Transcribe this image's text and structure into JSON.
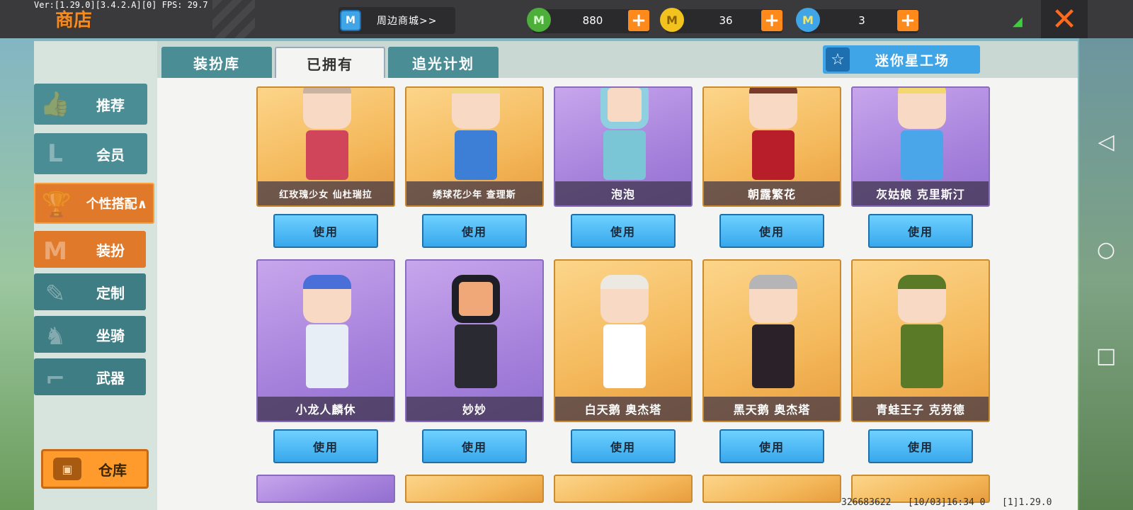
{
  "header": {
    "version": "Ver:[1.29.0][3.4.2.A][0] FPS: 29.7",
    "title": "商店",
    "mall_button": "周边商城>>",
    "mall_icon": "M",
    "currencies": [
      {
        "name": "mini-bean",
        "value": "880",
        "color": "#4caf3a",
        "icon": "M"
      },
      {
        "name": "mini-coin",
        "value": "36",
        "color": "#f2c21e",
        "icon": "M"
      },
      {
        "name": "mini-point",
        "value": "3",
        "color": "#3fa5e6",
        "icon": "M"
      }
    ],
    "plus": "+",
    "close": "✕"
  },
  "sidebar": {
    "items": [
      {
        "label": "推荐",
        "icon": "thumb-star-icon"
      },
      {
        "label": "会员",
        "icon": "l-badge-icon"
      },
      {
        "label": "个性搭配∧",
        "icon": "trophy-icon"
      },
      {
        "label": "装扮",
        "icon": "shirt-icon"
      },
      {
        "label": "定制",
        "icon": "pencil-ruler-icon"
      },
      {
        "label": "坐骑",
        "icon": "horse-icon"
      },
      {
        "label": "武器",
        "icon": "gun-icon"
      }
    ],
    "warehouse": "仓库"
  },
  "tabs": {
    "items": [
      "装扮库",
      "已拥有",
      "追光计划"
    ],
    "active": 1,
    "studio_button": "迷你星工场"
  },
  "cards_row1": [
    {
      "name": "红玫瑰少女 仙杜瑞拉",
      "bg": "gold",
      "skin": "#f7d9c4",
      "hair": "#c9b3a0",
      "outfit": "#d0455a"
    },
    {
      "name": "绣球花少年 查理斯",
      "bg": "gold",
      "skin": "#f7d9c4",
      "hair": "#f0d67c",
      "outfit": "#3d7fd6"
    },
    {
      "name": "泡泡",
      "bg": "purple",
      "skin": "#f7d9c4",
      "hair": "#8ed0e0",
      "outfit": "#7ac6d6"
    },
    {
      "name": "朝露繁花",
      "bg": "gold",
      "skin": "#f7d9c4",
      "hair": "#7a3a2a",
      "outfit": "#b81e2a"
    },
    {
      "name": "灰姑娘 克里斯汀",
      "bg": "purple",
      "skin": "#f7d9c4",
      "hair": "#f3d870",
      "outfit": "#4aa6e8"
    }
  ],
  "cards_row2": [
    {
      "name": "小龙人麟休",
      "bg": "purple",
      "skin": "#f7d9c4",
      "hair": "#4b6fd8",
      "outfit": "#e8eef6"
    },
    {
      "name": "妙妙",
      "bg": "purple",
      "skin": "#f0a878",
      "hair": "#1e1e26",
      "outfit": "#2a2a32"
    },
    {
      "name": "白天鹅 奥杰塔",
      "bg": "gold",
      "skin": "#f7d9c4",
      "hair": "#ece8e2",
      "outfit": "#ffffff"
    },
    {
      "name": "黑天鹅 奥杰塔",
      "bg": "gold",
      "skin": "#f7d9c4",
      "hair": "#b5b5b8",
      "outfit": "#2a2228"
    },
    {
      "name": "青蛙王子 克劳德",
      "bg": "gold",
      "skin": "#f7d9c4",
      "hair": "#f0d67c",
      "outfit": "#5a7a28"
    }
  ],
  "use_label": "使用",
  "footer": {
    "uid": "326683622",
    "time": "[10/03]16:34 0",
    "ver": "[1]1.29.0"
  }
}
